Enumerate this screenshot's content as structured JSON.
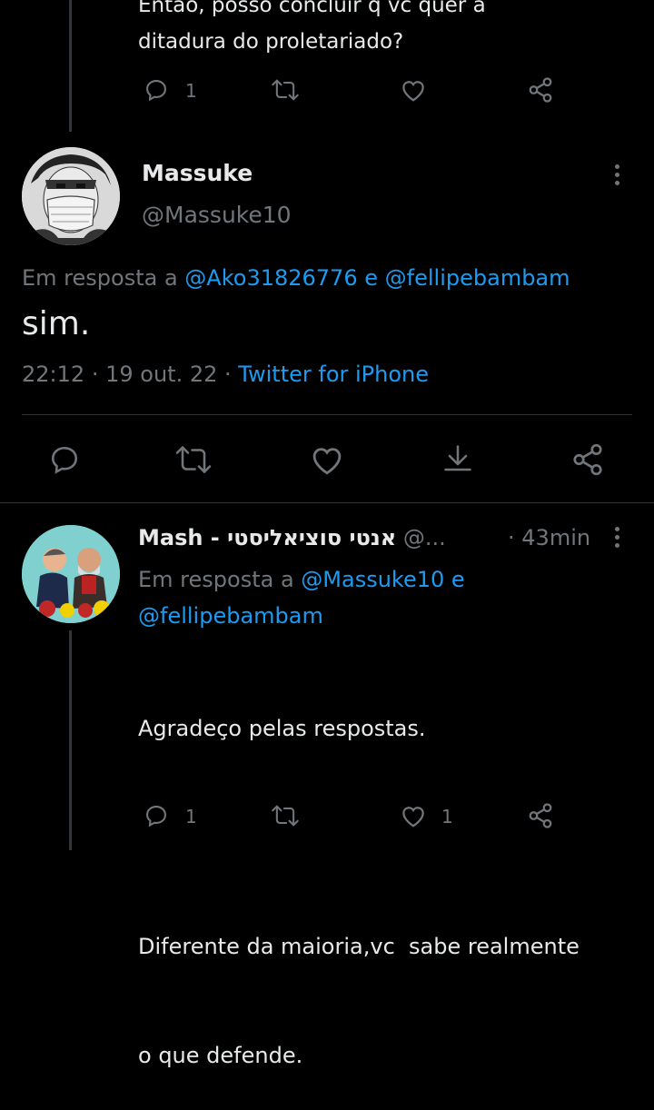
{
  "top_tweet": {
    "text_line1": "Então, posso concluir q vc quer a",
    "text_line2": "ditadura do proletariado?",
    "reply_count": "1"
  },
  "main_tweet": {
    "display_name": "Massuke",
    "handle": "@Massuke10",
    "reply_prefix": "Em resposta a",
    "reply_to_1": "@Ako31826776",
    "reply_join": "e",
    "reply_to_2": "@fellipebambam",
    "text": "sim.",
    "time": "22:12",
    "sep1": "·",
    "date": "19 out. 22",
    "sep2": "·",
    "source": "Twitter for iPhone"
  },
  "reply_tweet": {
    "display_name": "Mash - אנטי סוציאליסטי",
    "handle": "@...",
    "sep": "·",
    "time_ago": "43min",
    "reply_prefix": "Em resposta a",
    "reply_to_1": "@Massuke10",
    "reply_join": "e",
    "reply_to_2": "@fellipebambam",
    "text_line1": "Agradeço pelas respostas.",
    "text_line2": "Diferente da maioria,vc  sabe realmente",
    "text_line3": "o que defende.",
    "reply_count": "1",
    "like_count": "1"
  },
  "colors": {
    "background": "#000000",
    "text": "#e7e9ea",
    "muted": "#71767b",
    "link": "#1d9bf0",
    "divider": "#2f3336"
  },
  "icons": [
    "reply-icon",
    "retweet-icon",
    "like-icon",
    "share-icon",
    "bookmark-download-icon",
    "more-icon"
  ]
}
